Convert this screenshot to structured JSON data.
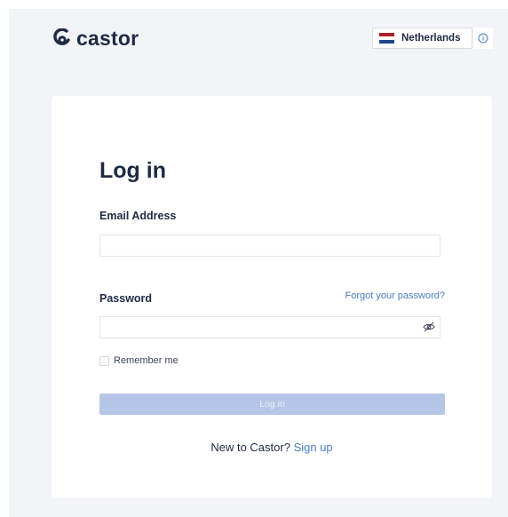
{
  "header": {
    "logo_text": "castor",
    "country": {
      "label": "Netherlands",
      "flag_colors": [
        "#ae1c28",
        "#ffffff",
        "#21468b"
      ]
    },
    "info_icon": "info-icon"
  },
  "login": {
    "title": "Log in",
    "email": {
      "label": "Email Address",
      "value": "",
      "placeholder": ""
    },
    "password": {
      "label": "Password",
      "value": "",
      "placeholder": "",
      "forgot_link": "Forgot your password?",
      "toggle_icon": "eye-off-icon"
    },
    "remember_label": "Remember me",
    "remember_checked": false,
    "submit_label": "Log in",
    "signup_prompt": "New to Castor?",
    "signup_link": "Sign up"
  },
  "colors": {
    "brand_dark": "#1f2a44",
    "link": "#4a7cc1",
    "button_disabled": "#b6c6e6",
    "page_bg": "#f3f4f7"
  }
}
